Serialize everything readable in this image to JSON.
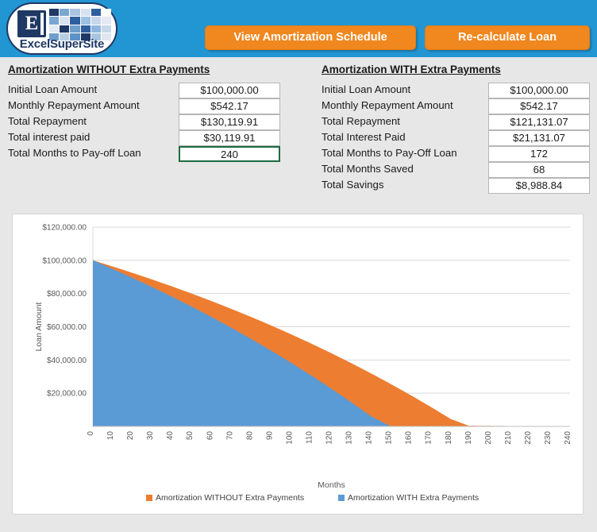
{
  "brand": {
    "logo_text": "ExcelSuperSite",
    "logo_letter": "E",
    "header_color": "#2196d3",
    "accent_color": "#f0871f"
  },
  "toolbar": {
    "view_schedule_label": "View Amortization Schedule",
    "recalculate_label": "Re-calculate Loan"
  },
  "panel_without": {
    "title": "Amortization WITHOUT Extra Payments",
    "rows": [
      {
        "label": "Initial Loan Amount",
        "value": "$100,000.00",
        "selected": false
      },
      {
        "label": "Monthly Repayment Amount",
        "value": "$542.17",
        "selected": false
      },
      {
        "label": "Total Repayment",
        "value": "$130,119.91",
        "selected": false
      },
      {
        "label": "Total interest paid",
        "value": "$30,119.91",
        "selected": false
      },
      {
        "label": "Total Months to Pay-off Loan",
        "value": "240",
        "selected": true
      }
    ]
  },
  "panel_with": {
    "title": "Amortization WITH Extra Payments",
    "rows": [
      {
        "label": "Initial Loan Amount",
        "value": "$100,000.00",
        "selected": false
      },
      {
        "label": "Monthly Repayment Amount",
        "value": "$542.17",
        "selected": false
      },
      {
        "label": "Total Repayment",
        "value": "$121,131.07",
        "selected": false
      },
      {
        "label": "Total Interest Paid",
        "value": "$21,131.07",
        "selected": false
      },
      {
        "label": "Total Months to Pay-Off Loan",
        "value": "172",
        "selected": false
      },
      {
        "label": "Total Months Saved",
        "value": "68",
        "selected": false
      },
      {
        "label": "Total Savings",
        "value": "$8,988.84",
        "selected": false
      }
    ]
  },
  "chart_data": {
    "type": "area",
    "title": "",
    "xlabel": "Months",
    "ylabel": "Loan Amount",
    "grid": true,
    "legend_position": "bottom",
    "xlim": [
      0,
      240
    ],
    "ylim": [
      0,
      120000
    ],
    "y_ticks": [
      0,
      20000,
      40000,
      60000,
      80000,
      100000,
      120000
    ],
    "y_tick_labels": [
      "",
      "$20,000.00",
      "$40,000.00",
      "$60,000.00",
      "$80,000.00",
      "$100,000.00",
      "$120,000.00"
    ],
    "x_ticks": [
      0,
      10,
      20,
      30,
      40,
      50,
      60,
      70,
      80,
      90,
      100,
      110,
      120,
      130,
      140,
      150,
      160,
      170,
      180,
      190,
      200,
      210,
      220,
      230,
      240
    ],
    "x_tick_labels": [
      "0",
      "10",
      "20",
      "30",
      "40",
      "50",
      "60",
      "70",
      "80",
      "90",
      "100",
      "110",
      "120",
      "130",
      "140",
      "150",
      "160",
      "170",
      "180",
      "190",
      "200",
      "210",
      "220",
      "230",
      "240"
    ],
    "series": [
      {
        "name": "Amortization WITHOUT Extra Payments",
        "color": "#ed7d31",
        "end_month": 240,
        "x": [
          0,
          10,
          20,
          30,
          40,
          50,
          60,
          70,
          80,
          90,
          100,
          110,
          120,
          130,
          140,
          150,
          160,
          170,
          180,
          190,
          200,
          210,
          220,
          230,
          240
        ],
        "values": [
          100000,
          96280,
          92410,
          88385,
          84198,
          79843,
          75313,
          70601,
          65700,
          60602,
          55300,
          49785,
          44048,
          38081,
          31874,
          25418,
          18701,
          11715,
          4447,
          0,
          0,
          0,
          0,
          0,
          0
        ]
      },
      {
        "name": "Amortization WITH Extra Payments",
        "color": "#5b9bd5",
        "end_month": 172,
        "x": [
          0,
          10,
          20,
          30,
          40,
          50,
          60,
          70,
          80,
          90,
          100,
          110,
          120,
          130,
          140,
          150,
          160,
          170,
          180,
          190,
          200,
          210,
          220,
          230,
          240
        ],
        "values": [
          100000,
          94800,
          89400,
          83800,
          77980,
          71940,
          65670,
          59160,
          52400,
          45380,
          38090,
          30520,
          22660,
          14500,
          6030,
          0,
          0,
          0,
          0,
          0,
          0,
          0,
          0,
          0,
          0
        ]
      }
    ],
    "legend": [
      {
        "label": "Amortization WITHOUT Extra Payments",
        "color": "#ed7d31"
      },
      {
        "label": "Amortization WITH Extra Payments",
        "color": "#5b9bd5"
      }
    ]
  }
}
